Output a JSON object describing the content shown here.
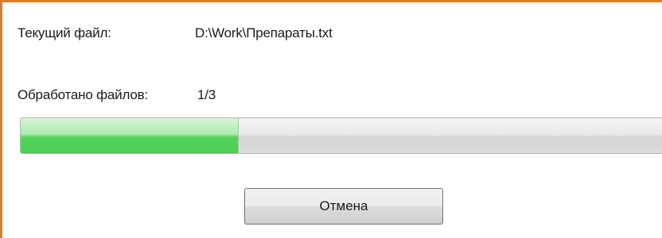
{
  "dialog": {
    "current_file_label": "Текущий файл:",
    "current_file_value": "D:\\Work\\Препараты.txt",
    "processed_label": "Обработано файлов:",
    "processed_value": "1/3",
    "progress": {
      "fraction": 0.3333
    },
    "cancel_label": "Отмена"
  },
  "colors": {
    "border_accent": "#d87f2c",
    "progress_fill": "#4ccf55",
    "progress_track": "#dcdcdc"
  }
}
